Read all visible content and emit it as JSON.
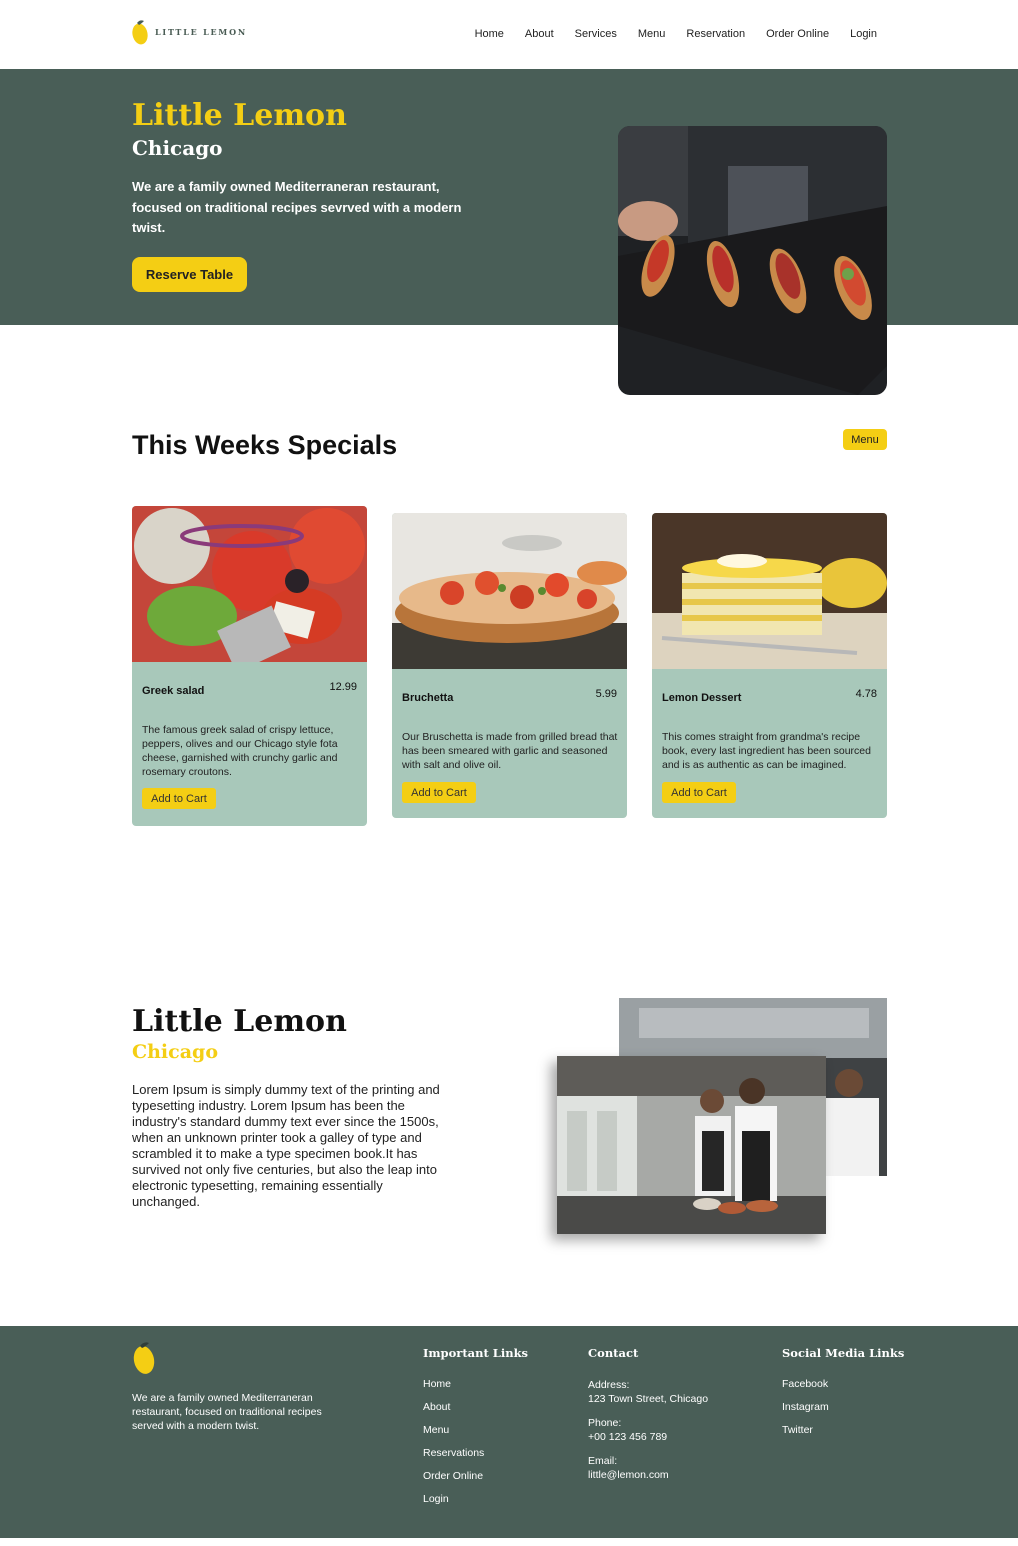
{
  "nav": {
    "brand": "LITTLE LEMON",
    "links": [
      "Home",
      "About",
      "Services",
      "Menu",
      "Reservation",
      "Order Online",
      "Login"
    ]
  },
  "hero": {
    "title": "Little Lemon",
    "subtitle": "Chicago",
    "description": "We are a family owned Mediterraneran restaurant, focused on traditional recipes sevrved with a modern twist.",
    "button": "Reserve Table"
  },
  "specials": {
    "title": "This Weeks Specials",
    "menu_button": "Menu",
    "cards": [
      {
        "name": "Greek salad",
        "price": "12.99",
        "description": "The famous greek salad of crispy lettuce, peppers, olives and our Chicago style fota cheese, garnished with crunchy garlic and rosemary croutons.",
        "button": "Add to Cart"
      },
      {
        "name": "Bruchetta",
        "price": "5.99",
        "description": "Our Bruschetta is made from grilled bread that has been smeared with garlic and seasoned with salt and olive oil.",
        "button": "Add to Cart"
      },
      {
        "name": "Lemon Dessert",
        "price": "4.78",
        "description": "This comes straight from grandma's recipe book, every last ingredient has been sourced and is as authentic as can be imagined.",
        "button": "Add to Cart"
      }
    ]
  },
  "about": {
    "title": "Little Lemon",
    "subtitle": "Chicago",
    "text": "Lorem Ipsum is simply dummy text of the printing and typesetting industry. Lorem Ipsum has been the industry's standard dummy text ever since the 1500s, when an unknown printer took a galley of type and scrambled it to make a type specimen book.It has survived not only five centuries, but also the leap into electronic typesetting, remaining essentially unchanged."
  },
  "footer": {
    "about": "We are a family owned Mediterraneran restaurant, focused on traditional recipes served with a modern twist.",
    "links_title": "Important Links",
    "links": [
      "Home",
      "About",
      "Menu",
      "Reservations",
      "Order Online",
      "Login"
    ],
    "contact_title": "Contact",
    "address_label": "Address:",
    "address": "123 Town Street, Chicago",
    "phone_label": "Phone:",
    "phone": "+00 123 456 789",
    "email_label": "Email:",
    "email": "little@lemon.com",
    "social_title": "Social Media Links",
    "social": [
      "Facebook",
      "Instagram",
      "Twitter"
    ]
  },
  "colors": {
    "primary_green": "#495e57",
    "primary_yellow": "#f4ce14",
    "card_bg": "#a8c8ba"
  },
  "icons": {
    "logo": "lemon-icon"
  }
}
